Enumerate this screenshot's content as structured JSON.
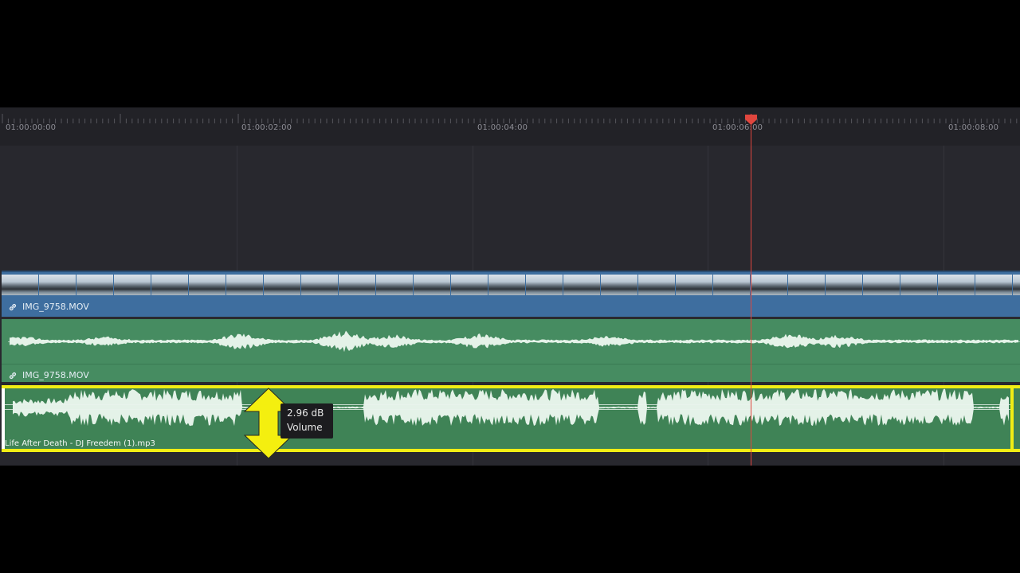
{
  "ruler": {
    "timecodes": [
      "01:00:00:00",
      "01:00:02:00",
      "01:00:04:00",
      "01:00:06:00",
      "01:00:08:00"
    ]
  },
  "video_track": {
    "clip_name": "IMG_9758.MOV",
    "color": "#3e6e9f"
  },
  "audio_track_1": {
    "clip_name": "IMG_9758.MOV",
    "color": "#468c61"
  },
  "audio_track_2": {
    "clip_name": "Life After Death - DJ Freedem (1).mp3",
    "color": "#3f8356",
    "selection_color": "#f1ee14"
  },
  "volume_tooltip": {
    "value": "2.96 dB",
    "label": "Volume"
  },
  "playhead": {
    "timecode": "01:00:06:10",
    "color": "#e0463e"
  },
  "icons": {
    "link": "link-icon",
    "volume_drag": "vertical-resize-arrow-icon",
    "playhead": "playhead-marker-icon"
  }
}
